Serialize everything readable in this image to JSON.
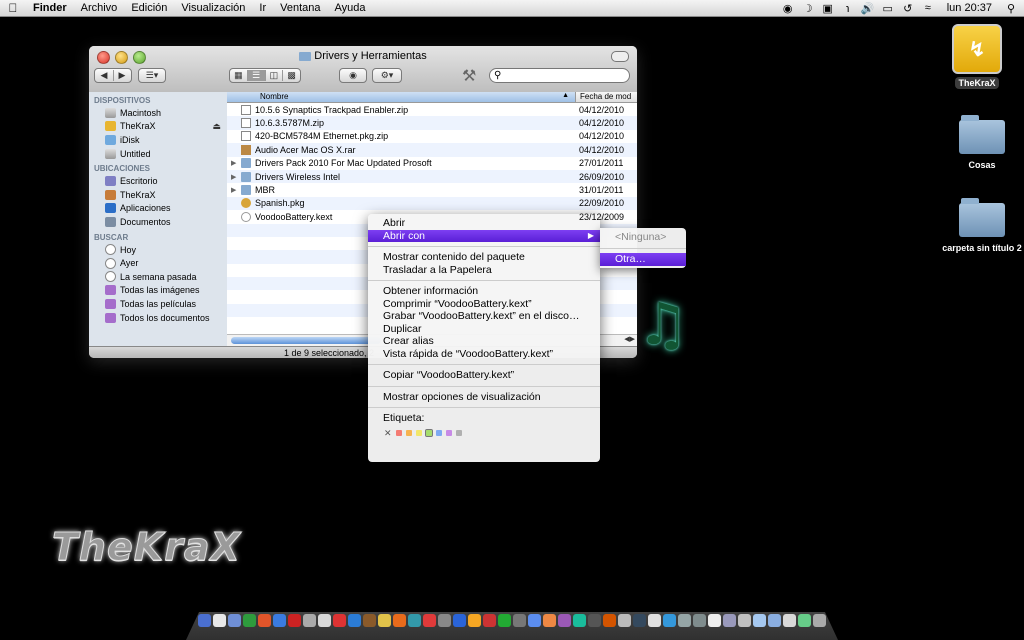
{
  "menubar": {
    "apple": "",
    "items": [
      "Finder",
      "Archivo",
      "Edición",
      "Visualización",
      "Ir",
      "Ventana",
      "Ayuda"
    ],
    "clock": "lun 20:37"
  },
  "desktop": {
    "drive_label": "TheKraX",
    "folders": [
      {
        "label": "Cosas"
      },
      {
        "label": "carpeta sin título 2"
      }
    ]
  },
  "finder": {
    "title": "Drivers y Herramientas",
    "search_value": "",
    "sidebar": {
      "sections": [
        {
          "title": "DISPOSITIVOS",
          "items": [
            "Macintosh",
            "TheKraX",
            "iDisk",
            "Untitled"
          ]
        },
        {
          "title": "UBICACIONES",
          "items": [
            "Escritorio",
            "TheKraX",
            "Aplicaciones",
            "Documentos"
          ]
        },
        {
          "title": "BUSCAR",
          "items": [
            "Hoy",
            "Ayer",
            "La semana pasada",
            "Todas las imágenes",
            "Todas las películas",
            "Todos los documentos"
          ]
        }
      ]
    },
    "columns": {
      "name": "Nombre",
      "date": "Fecha de mod"
    },
    "files": [
      {
        "name": "10.5.6 Synaptics Trackpad Enabler.zip",
        "date": "04/12/2010",
        "type": "zip",
        "label": "#9fe06a"
      },
      {
        "name": "10.6.3.5787M.zip",
        "date": "04/12/2010",
        "type": "zip",
        "label": "#9fe06a"
      },
      {
        "name": "420-BCM5784M Ethernet.pkg.zip",
        "date": "04/12/2010",
        "type": "zip",
        "label": "#9fe06a"
      },
      {
        "name": "Audio Acer Mac OS X.rar",
        "date": "04/12/2010",
        "type": "rar",
        "label": "#9fe06a"
      },
      {
        "name": "Drivers Pack 2010 For Mac Updated Prosoft",
        "date": "27/01/2011",
        "type": "folder",
        "label": "#f0ea5a"
      },
      {
        "name": "Drivers Wireless Intel",
        "date": "26/09/2010",
        "type": "folder",
        "label": "#f27b6e"
      },
      {
        "name": "MBR",
        "date": "31/01/2011",
        "type": "folder",
        "label": ""
      },
      {
        "name": "Spanish.pkg",
        "date": "22/09/2010",
        "type": "pkg",
        "label": "#8fb6ec"
      },
      {
        "name": "VoodooBattery.kext",
        "date": "23/12/2009",
        "type": "kext",
        "label": ""
      }
    ],
    "status": "1 de 9 seleccionado, 2"
  },
  "context_menu": {
    "items": [
      {
        "label": "Abrir"
      },
      {
        "label": "Abrir con",
        "submenu": true
      },
      {
        "sep": true
      },
      {
        "label": "Mostrar contenido del paquete"
      },
      {
        "label": "Trasladar a la Papelera"
      },
      {
        "sep": true
      },
      {
        "label": "Obtener información"
      },
      {
        "label": "Comprimir “VoodooBattery.kext”"
      },
      {
        "label": "Grabar “VoodooBattery.kext” en el disco…"
      },
      {
        "label": "Duplicar"
      },
      {
        "label": "Crear alias"
      },
      {
        "label": "Vista rápida de “VoodooBattery.kext”"
      },
      {
        "sep": true
      },
      {
        "label": "Copiar “VoodooBattery.kext”"
      },
      {
        "sep": true
      },
      {
        "label": "Mostrar opciones de visualización"
      },
      {
        "sep": true
      }
    ],
    "label_heading": "Etiqueta:",
    "label_colors": [
      "#f47b73",
      "#f6b34f",
      "#f2e76a",
      "#a5dd6c",
      "#7ea9f2",
      "#c78ae6",
      "#b0b0b0"
    ],
    "submenu": {
      "none": "<Ninguna>",
      "other": "Otra…"
    }
  },
  "logo_text": "TheKraX",
  "colors": {
    "highlight": "#6a2ff0",
    "selection": "#3875d7"
  }
}
